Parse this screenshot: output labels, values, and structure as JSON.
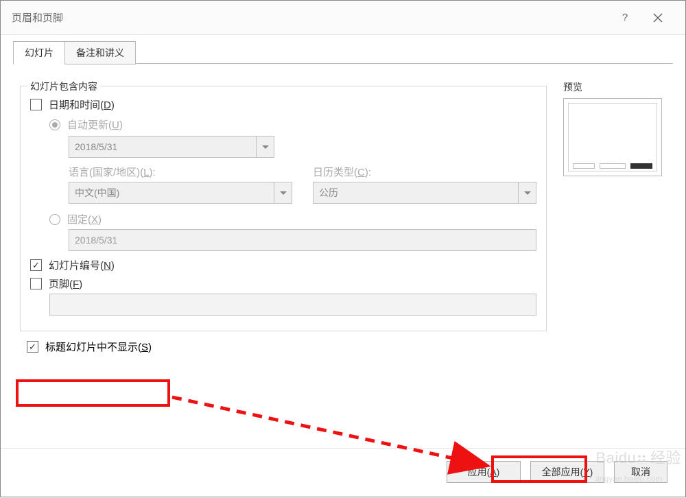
{
  "dialog": {
    "title": "页眉和页脚"
  },
  "tabs": {
    "slide": "幻灯片",
    "notes": "备注和讲义"
  },
  "groupbox": {
    "legend": "幻灯片包含内容"
  },
  "checkbox": {
    "datetime_label": "日期和时间(",
    "datetime_accel": "D",
    "datetime_suffix": ")",
    "slidenum_label": "幻灯片编号(",
    "slidenum_accel": "N",
    "slidenum_suffix": ")",
    "footer_label": "页脚(",
    "footer_accel": "F",
    "footer_suffix": ")",
    "hide_title_label": "标题幻灯片中不显示(",
    "hide_title_accel": "S",
    "hide_title_suffix": ")"
  },
  "radio": {
    "auto_label": "自动更新(",
    "auto_accel": "U",
    "auto_suffix": ")",
    "fixed_label": "固定(",
    "fixed_accel": "X",
    "fixed_suffix": ")"
  },
  "combo": {
    "date_value": "2018/5/31",
    "lang_label": "语言(国家/地区)(",
    "lang_accel": "L",
    "lang_suffix": "):",
    "lang_value": "中文(中国)",
    "cal_label": "日历类型(",
    "cal_accel": "C",
    "cal_suffix": "):",
    "cal_value": "公历"
  },
  "textbox": {
    "fixed_value": "2018/5/31",
    "footer_value": ""
  },
  "preview": {
    "label": "预览"
  },
  "buttons": {
    "apply": "应用(",
    "apply_accel": "A",
    "apply_suffix": ")",
    "apply_all": "全部应用(",
    "apply_all_accel": "Y",
    "apply_all_suffix": ")",
    "cancel": "取消"
  },
  "watermark": "Baidu"
}
